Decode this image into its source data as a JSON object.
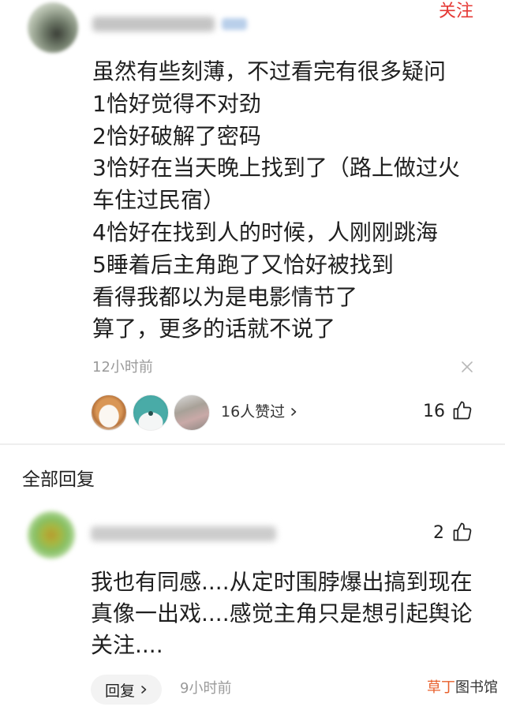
{
  "post": {
    "follow_label": "关注",
    "lines": [
      "虽然有些刻薄，不过看完有很多疑问",
      "1恰好觉得不对劲",
      "2恰好破解了密码",
      "3恰好在当天晚上找到了（路上做过火",
      "车住过民宿）",
      "4恰好在找到人的时候，人刚刚跳海",
      "5睡着后主角跑了又恰好被找到",
      "看得我都以为是电影情节了",
      "算了，更多的话就不说了"
    ],
    "time": "12小时前",
    "likes": {
      "summary": "16人赞过",
      "count": "16"
    }
  },
  "replies_section": {
    "title": "全部回复"
  },
  "reply": {
    "like_count": "2",
    "lines": [
      "我也有同感....从定时围脖爆出搞到现在",
      "真像一出戏....感觉主角只是想引起舆论",
      "关注...."
    ],
    "reply_button": "回复",
    "time": "9小时前"
  },
  "watermark": {
    "part1": "草丁",
    "part2": "图书馆"
  },
  "colors": {
    "follow_red": "#e53935",
    "watermark_orange": "#e8602c",
    "text": "#1f1f1f",
    "muted": "#9a9a9a"
  },
  "icons": {
    "like": "thumbs-up-icon",
    "close": "close-icon",
    "chevron": "chevron-right-icon"
  }
}
